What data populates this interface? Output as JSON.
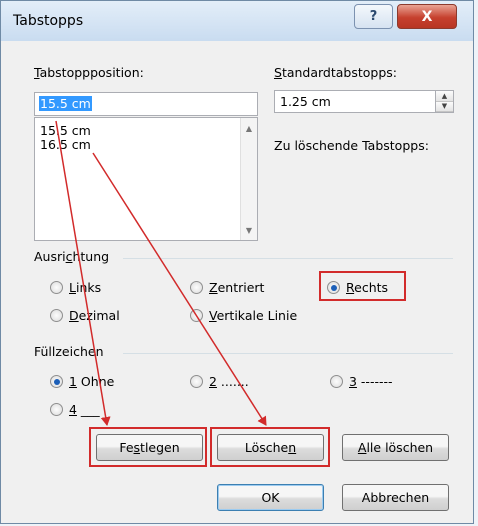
{
  "window": {
    "title": "Tabstopps",
    "help_label": "?",
    "close_label": "X"
  },
  "tab_position": {
    "label_u": "T",
    "label_rest": "abstoppposition:",
    "value": "15.5 cm",
    "list": [
      "15.5 cm",
      "16.5 cm"
    ]
  },
  "default_tabs": {
    "label_u": "S",
    "label_rest": "tandardtabstopps:",
    "value": "1.25 cm"
  },
  "to_delete": {
    "label": "Zu löschende Tabstopps:"
  },
  "alignment": {
    "group_pre": "Ausri",
    "group_u": "c",
    "group_post": "htung",
    "options": {
      "left": {
        "u": "L",
        "rest": "inks"
      },
      "center": {
        "u": "Z",
        "rest": "entriert"
      },
      "right": {
        "u": "R",
        "rest": "echts"
      },
      "decimal": {
        "u": "D",
        "rest": "ezimal"
      },
      "bar": {
        "u": "V",
        "rest": "ertikale Linie"
      }
    },
    "selected": "right"
  },
  "leader": {
    "group_label": "Füllzeichen",
    "options": {
      "o1": {
        "u": "1",
        "rest": " Ohne"
      },
      "o2": {
        "u": "2",
        "rest": " ......."
      },
      "o3": {
        "u": "3",
        "rest": " -------"
      },
      "o4": {
        "u": "4",
        "rest": " ___"
      }
    },
    "selected": "o1"
  },
  "buttons": {
    "set": {
      "pre": "Fe",
      "u": "s",
      "post": "tlegen"
    },
    "clear": {
      "pre": "Lösche",
      "u": "n",
      "post": ""
    },
    "clear_all": {
      "pre": "",
      "u": "A",
      "post": "lle löschen"
    },
    "ok": "OK",
    "cancel": "Abbrechen"
  },
  "colors": {
    "highlight": "#d22b2b",
    "selection": "#3399ff",
    "close": "#c6402e"
  }
}
